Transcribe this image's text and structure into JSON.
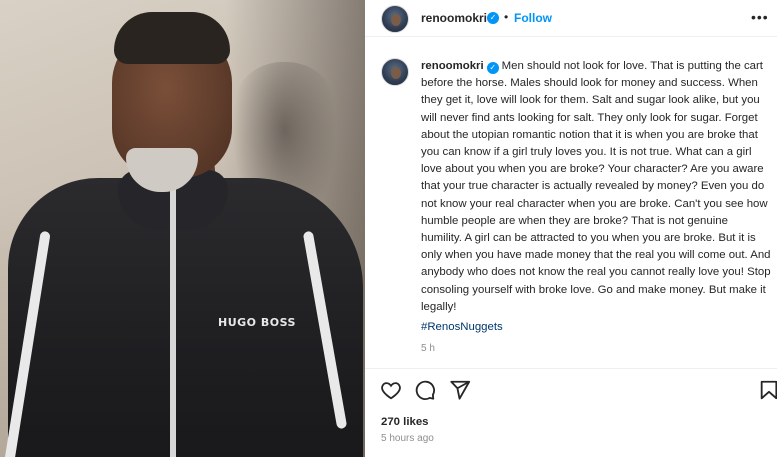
{
  "photo": {
    "logo_text": "HUGO BOSS"
  },
  "header": {
    "username": "renoomokri",
    "verified_icon": "verified-badge-icon",
    "separator": "•",
    "follow_label": "Follow",
    "more_icon": "more-options-icon"
  },
  "caption": {
    "username": "renoomokri",
    "text": "Men should not look for love. That is putting the cart before the horse. Males should look for money and success. When they get it, love will look for them. Salt and sugar look alike, but you will never find ants looking for salt. They only look for sugar. Forget about the utopian romantic notion that it is when you are broke that you can know if a girl truly loves you. It is not true. What can a girl love about you when you are broke? Your character? Are you aware that your true character is actually revealed by money? Even you do not know your real character when you are broke. Can't you see how humble people are when they are broke? That is not genuine humility. A girl can be attracted to you when you are broke. But it is only when you have made money that the real you will come out. And anybody who does not know the real you cannot really love you! Stop consoling yourself with broke love. Go and make money. But make it legally!",
    "hashtag": "#RenosNuggets",
    "time": "5 h"
  },
  "actions": {
    "icons": [
      "heart-icon",
      "comment-icon",
      "share-icon",
      "bookmark-icon"
    ],
    "likes": "270 likes",
    "posted_ago": "5 hours ago"
  },
  "colors": {
    "accent": "#0095f6",
    "hashtag": "#00376b",
    "muted": "#8e8e8e",
    "text": "#262626"
  }
}
